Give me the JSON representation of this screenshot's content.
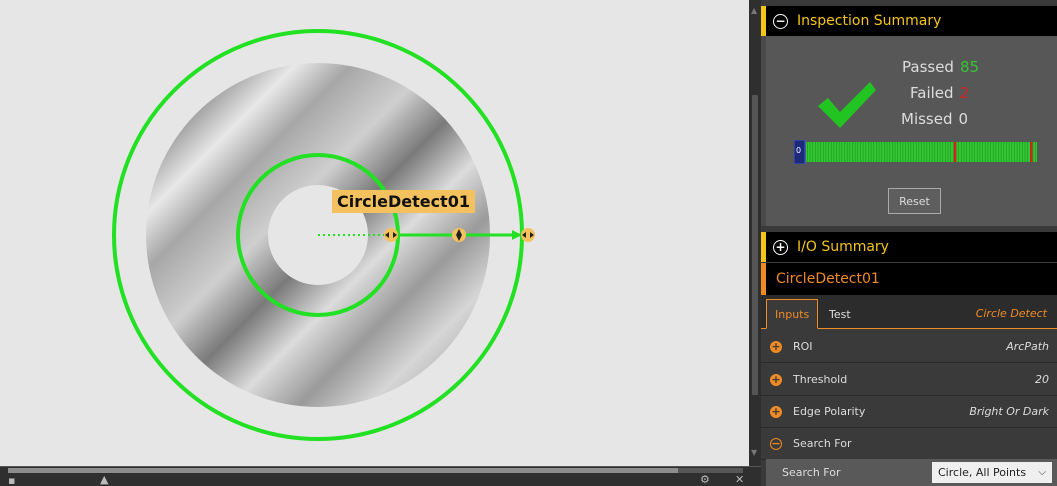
{
  "canvas": {
    "tool_label": "CircleDetect01",
    "overlay_color": "#22e022",
    "handle_color": "#f3c25e"
  },
  "inspection_summary": {
    "title": "Inspection Summary",
    "passed_label": "Passed",
    "passed_value": "85",
    "failed_label": "Failed",
    "failed_value": "2",
    "missed_label": "Missed",
    "missed_value": "0",
    "passed_color": "#33c533",
    "failed_color": "#d22222",
    "reset_label": "Reset",
    "history_marker": "0"
  },
  "io_summary": {
    "title": "I/O Summary"
  },
  "tool_panel": {
    "title": "CircleDetect01",
    "tabs": [
      {
        "label": "Inputs",
        "active": true
      },
      {
        "label": "Test",
        "active": false
      }
    ],
    "tool_type": "Circle Detect",
    "params": [
      {
        "label": "ROI",
        "value": "ArcPath",
        "icon": "plus-circle-icon"
      },
      {
        "label": "Threshold",
        "value": "20",
        "icon": "plus-circle-icon"
      },
      {
        "label": "Edge Polarity",
        "value": "Bright Or Dark",
        "icon": "plus-circle-icon"
      },
      {
        "label": "Search For",
        "value": "",
        "icon": "minus-circle-icon"
      }
    ],
    "search_for": {
      "label": "Search For",
      "value": "Circle, All Points"
    }
  },
  "colors": {
    "accent_yellow": "#f5c518",
    "accent_orange": "#f08a24"
  }
}
